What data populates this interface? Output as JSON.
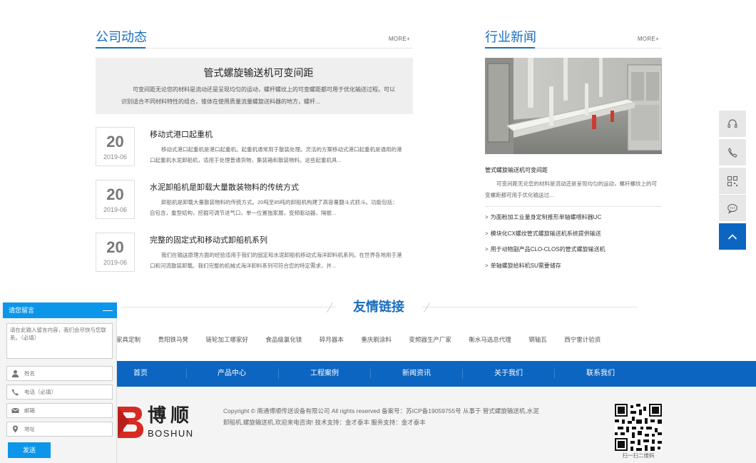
{
  "company_news": {
    "title": "公司动态",
    "more": "MORE+",
    "featured": {
      "title": "管式螺旋输送机可变间距",
      "desc": "可变间距无论您的材料是流动还是呈现均匀的运动，螺杆螺纹上的可变螺距都可用于优化输送过程。可以识别适合不同材料特性的组合，锥体在使用质量流量螺旋送料器的地方，螺杆..."
    },
    "items": [
      {
        "day": "20",
        "ym": "2019-06",
        "title": "移动式港口起重机",
        "desc": "移动式港口起重机是港口起重机。起重机通常用于散装处理。灵活的方案移动式港口起重机是通用的港口起重机水泥卸船机，适用于处理普通货物，集装箱和散装物料。这些起重机具..."
      },
      {
        "day": "20",
        "ym": "2019-06",
        "title": "水泥卸船机是卸载大量散装物料的传统方式",
        "desc": "卸船机是卸载大量散装物料的传统方式。20吨至85吨的卸船机构建了高容量翻斗式抓斗。功能包括：自包含，重型结构，挖掘可调节进气口，单一位置独家展，变频驱动器，隔振..."
      },
      {
        "day": "20",
        "ym": "2019-06",
        "title": "完整的固定式和移动式卸船机系列",
        "desc": "我们在输送原理方面的经验适用于我们的固定和水泥卸船机移动式海洋卸料机系列。在世界各地用于港口和河流散装卸载。我们完整的机械式海洋卸料系列可符合您的特定需求，并..."
      }
    ]
  },
  "industry_news": {
    "title": "行业新闻",
    "more": "MORE+",
    "feature_title": "管式螺旋输送机可变间距",
    "feature_desc": "可变间距无论您的材料是流动还是呈现均匀的运动，螺杆螺纹上的可变螺距都可用于优化输送过...",
    "list": [
      "为面粉加工业量身定制推形单轴螺喂料器UC",
      "模块化CX螺纹管式螺旋输送机系统提供输送",
      "用于动物副产品CLO-CLOS的管式螺旋输送机",
      "单轴螺旋给料机SU需要储存"
    ]
  },
  "links": {
    "title": "友情链接",
    "items": [
      "家具定制",
      "贵阳铁马凳",
      "链轮加工哪家好",
      "食品级氯化镁",
      "碎月器本",
      "重庆刷涂料",
      "变频器生产厂家",
      "衡水马选总代理",
      "钢轴瓦",
      "西宁雷计验资"
    ]
  },
  "nav": {
    "items": [
      "首页",
      "产品中心",
      "工程案例",
      "新闻资讯",
      "关于我们",
      "联系我们"
    ]
  },
  "footer": {
    "logo_cn": "博顺",
    "logo_en": "BOSHUN",
    "copyright": "Copyright © 南通博顺传送设备有限公司 All rights reserved 备案号：苏ICP备19059755号 从事于 管式螺旋输送机,水泥卸船机,螺旋输送机,欢迎来电咨询! 技术支持：金才泰丰 服务支持：金才泰丰",
    "qr_caption": "扫一扫二维码"
  },
  "float_bar": {
    "icons": [
      "headset-icon",
      "phone-icon",
      "qrcode-icon",
      "chat-icon",
      "back-to-top-icon"
    ],
    "accent": "#0c65c1"
  },
  "message": {
    "title": "请您留言",
    "minimize": "—",
    "textarea_placeholder": "请在此输入留言内容，我们会尽快与您联系。（必填）",
    "name_placeholder": "姓名",
    "phone_placeholder": "电话（必填）",
    "email_placeholder": "邮箱",
    "address_placeholder": "地址",
    "send": "发送",
    "accent": "#0c96ea"
  }
}
